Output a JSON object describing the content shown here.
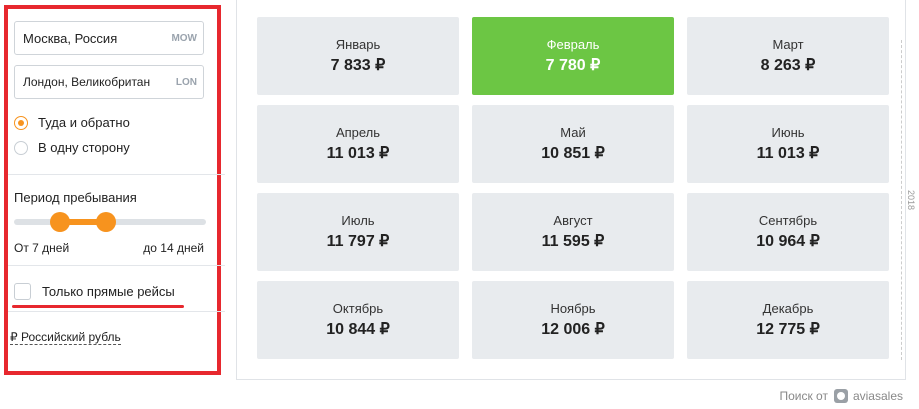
{
  "search": {
    "origin": {
      "city": "Москва, Россия",
      "code": "MOW"
    },
    "destination": {
      "city": "Лондон, Великобритан",
      "code": "LON"
    },
    "trip_type": {
      "round_trip_label": "Туда и обратно",
      "one_way_label": "В одну сторону",
      "selected": "round_trip"
    },
    "stay": {
      "title": "Период пребывания",
      "from_label": "От 7 дней",
      "to_label": "до 14 дней",
      "min_days": 7,
      "max_days": 14
    },
    "direct_only_label": "Только прямые рейсы",
    "direct_only_checked": false,
    "currency_label": "₽ Российский рубль"
  },
  "months": [
    {
      "name": "Январь",
      "price": "7 833 ₽"
    },
    {
      "name": "Февраль",
      "price": "7 780 ₽",
      "active": true
    },
    {
      "name": "Март",
      "price": "8 263 ₽"
    },
    {
      "name": "Апрель",
      "price": "11 013 ₽"
    },
    {
      "name": "Май",
      "price": "10 851 ₽"
    },
    {
      "name": "Июнь",
      "price": "11 013 ₽"
    },
    {
      "name": "Июль",
      "price": "11 797 ₽"
    },
    {
      "name": "Август",
      "price": "11 595 ₽"
    },
    {
      "name": "Сентябрь",
      "price": "10 964 ₽"
    },
    {
      "name": "Октябрь",
      "price": "10 844 ₽"
    },
    {
      "name": "Ноябрь",
      "price": "12 006 ₽"
    },
    {
      "name": "Декабрь",
      "price": "12 775 ₽"
    }
  ],
  "side_label": "2018",
  "footer": {
    "prefix": "Поиск от",
    "brand": "aviasales"
  },
  "colors": {
    "accent_orange": "#f7931e",
    "active_green": "#6cc644",
    "highlight_red": "#e7282e"
  }
}
